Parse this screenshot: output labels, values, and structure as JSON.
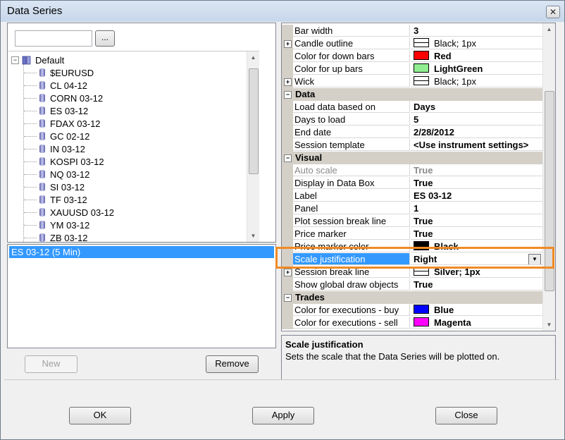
{
  "window": {
    "title": "Data Series",
    "close_glyph": "✕"
  },
  "left": {
    "search_value": "",
    "browse_label": "...",
    "tree_root": "Default",
    "instruments": [
      "$EURUSD",
      "CL 04-12",
      "CORN 03-12",
      "ES 03-12",
      "FDAX 03-12",
      "GC 02-12",
      "IN 03-12",
      "KOSPI 03-12",
      "NQ 03-12",
      "SI 03-12",
      "TF 03-12",
      "XAUUSD 03-12",
      "YM 03-12",
      "ZB 03-12"
    ],
    "selected_series": "ES 03-12 (5 Min)",
    "new_label": "New",
    "remove_label": "Remove"
  },
  "grid": {
    "rows": [
      {
        "type": "prop",
        "name": "Bar width",
        "value": "3"
      },
      {
        "type": "prop",
        "name": "Candle outline",
        "value": "Black; 1px",
        "expand": "+",
        "swatch": "line",
        "bold": false
      },
      {
        "type": "prop",
        "name": "Color for down bars",
        "value": "Red",
        "swatch": "#ff0000"
      },
      {
        "type": "prop",
        "name": "Color for up bars",
        "value": "LightGreen",
        "swatch": "#90ee90"
      },
      {
        "type": "prop",
        "name": "Wick",
        "value": "Black; 1px",
        "expand": "+",
        "swatch": "line",
        "bold": false
      },
      {
        "type": "cat",
        "name": "Data",
        "expand": "−"
      },
      {
        "type": "prop",
        "name": "Load data based on",
        "value": "Days"
      },
      {
        "type": "prop",
        "name": "Days to load",
        "value": "5"
      },
      {
        "type": "prop",
        "name": "End date",
        "value": "2/28/2012"
      },
      {
        "type": "prop",
        "name": "Session template",
        "value": "<Use instrument settings>"
      },
      {
        "type": "cat",
        "name": "Visual",
        "expand": "−"
      },
      {
        "type": "prop",
        "name": "Auto scale",
        "value": "True",
        "dim": true
      },
      {
        "type": "prop",
        "name": "Display in Data Box",
        "value": "True"
      },
      {
        "type": "prop",
        "name": "Label",
        "value": "ES 03-12"
      },
      {
        "type": "prop",
        "name": "Panel",
        "value": "1"
      },
      {
        "type": "prop",
        "name": "Plot session break line",
        "value": "True"
      },
      {
        "type": "prop",
        "name": "Price marker",
        "value": "True"
      },
      {
        "type": "prop",
        "name": "Price marker color",
        "value": "Black",
        "swatch": "#000000"
      },
      {
        "type": "prop",
        "name": "Scale justification",
        "value": "Right",
        "selected": true,
        "dropdown": true
      },
      {
        "type": "prop",
        "name": "Session break line",
        "value": "Silver; 1px",
        "expand": "+",
        "swatch": "line"
      },
      {
        "type": "prop",
        "name": "Show global draw objects",
        "value": "True"
      },
      {
        "type": "cat",
        "name": "Trades",
        "expand": "−"
      },
      {
        "type": "prop",
        "name": "Color for executions - buy",
        "value": "Blue",
        "swatch": "#0000ff"
      },
      {
        "type": "prop",
        "name": "Color for executions - sell",
        "value": "Magenta",
        "swatch": "#ff00ff"
      }
    ],
    "description_title": "Scale justification",
    "description_text": "Sets the scale that the Data Series will be plotted on."
  },
  "buttons": {
    "ok": "OK",
    "apply": "Apply",
    "close": "Close"
  },
  "colors": {
    "selection": "#3399ff",
    "highlight": "#f08a24"
  }
}
